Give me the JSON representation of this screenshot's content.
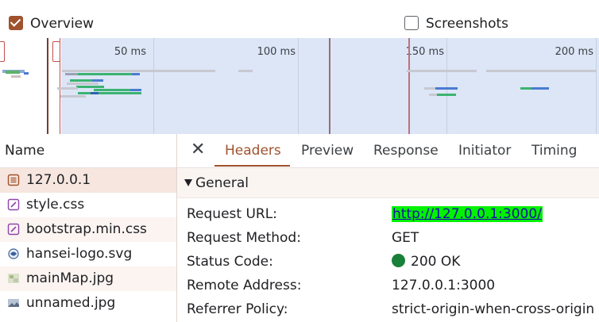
{
  "options": {
    "overview": {
      "label": "Overview",
      "checked": true
    },
    "screenshots": {
      "label": "Screenshots",
      "checked": false
    }
  },
  "timeline": {
    "ticks": [
      "50 ms",
      "100 ms",
      "150 ms",
      "200 ms"
    ]
  },
  "network": {
    "name_header": "Name",
    "files": [
      {
        "name": "127.0.0.1",
        "icon": "document-icon",
        "selected": true
      },
      {
        "name": "style.css",
        "icon": "stylesheet-icon"
      },
      {
        "name": "bootstrap.min.css",
        "icon": "stylesheet-icon"
      },
      {
        "name": "hansei-logo.svg",
        "icon": "svg-image-icon"
      },
      {
        "name": "mainMap.jpg",
        "icon": "image-icon"
      },
      {
        "name": "unnamed.jpg",
        "icon": "image-icon"
      }
    ]
  },
  "details": {
    "tabs": [
      "Headers",
      "Preview",
      "Response",
      "Initiator",
      "Timing"
    ],
    "active_tab": "Headers",
    "section_title": "General",
    "fields": [
      {
        "key": "Request URL:",
        "value": "http://127.0.0.1:3000/"
      },
      {
        "key": "Request Method:",
        "value": "GET"
      },
      {
        "key": "Status Code:",
        "value": "200 OK"
      },
      {
        "key": "Remote Address:",
        "value": "127.0.0.1:3000"
      },
      {
        "key": "Referrer Policy:",
        "value": "strict-origin-when-cross-origin"
      }
    ]
  },
  "colors": {
    "accent": "#a0522d",
    "status_ok": "#188038",
    "url_highlight": "#00f200",
    "overview_selection": "#dce6f7"
  }
}
